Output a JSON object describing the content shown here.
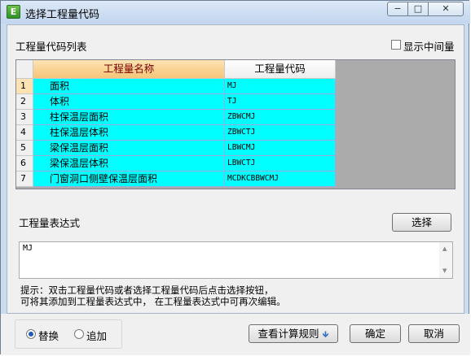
{
  "window": {
    "title": "选择工程量代码",
    "icon_glyph": "E",
    "controls": {
      "minimize": "−",
      "maximize": "□",
      "close": "✕"
    }
  },
  "list_label": "工程量代码列表",
  "show_intermediate": {
    "label": "显示中间量",
    "checked": false
  },
  "table": {
    "headers": {
      "name": "工程量名称",
      "code": "工程量代码"
    },
    "rows": [
      {
        "num": "1",
        "name": "面积",
        "code": "MJ"
      },
      {
        "num": "2",
        "name": "体积",
        "code": "TJ"
      },
      {
        "num": "3",
        "name": "柱保温层面积",
        "code": "ZBWCMJ"
      },
      {
        "num": "4",
        "name": "柱保温层体积",
        "code": "ZBWCTJ"
      },
      {
        "num": "5",
        "name": "梁保温层面积",
        "code": "LBWCMJ"
      },
      {
        "num": "6",
        "name": "梁保温层体积",
        "code": "LBWCTJ"
      },
      {
        "num": "7",
        "name": "门窗洞口侧壁保温层面积",
        "code": "MCDKCBBWCMJ"
      }
    ],
    "row_color": "#00ffff"
  },
  "expression": {
    "label": "工程量表达式",
    "select_button": "选择",
    "value": "MJ"
  },
  "hint": {
    "line1": "提示：双击工程量代码或者选择工程量代码后点击选择按钮，",
    "line2": "可将其添加到工程量表达式中， 在工程量表达式中可再次编辑。"
  },
  "mode": {
    "replace_label": "替换",
    "append_label": "追加",
    "selected": "替换"
  },
  "buttons": {
    "view_rules": "查看计算规则",
    "view_rules_icon": "arrow-down-icon",
    "ok": "确定",
    "cancel": "取消"
  }
}
